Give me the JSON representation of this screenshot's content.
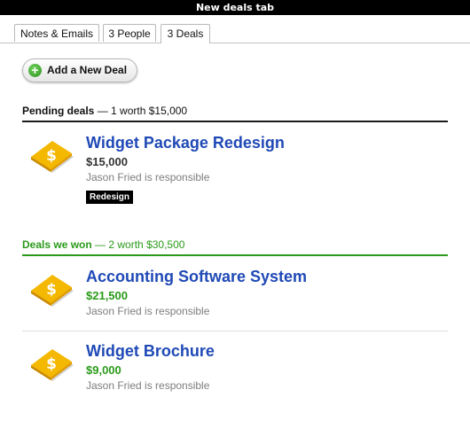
{
  "window": {
    "title": "New deals tab"
  },
  "tabs": [
    {
      "label": "Notes & Emails"
    },
    {
      "label": "3 People"
    },
    {
      "label": "3 Deals"
    }
  ],
  "add_button": {
    "label": "Add a New Deal"
  },
  "pending": {
    "title": "Pending deals",
    "summary": "— 1 worth $15,000",
    "color": "#111111",
    "deals": [
      {
        "name": "Widget Package Redesign",
        "amount": "$15,000",
        "responsible": "Jason Fried is responsible",
        "tag": "Redesign"
      }
    ]
  },
  "won": {
    "title": "Deals we won",
    "summary": "— 2 worth $30,500",
    "color": "#2a9a1a",
    "deals": [
      {
        "name": "Accounting Software System",
        "amount": "$21,500",
        "responsible": "Jason Fried is responsible"
      },
      {
        "name": "Widget Brochure",
        "amount": "$9,000",
        "responsible": "Jason Fried is responsible"
      }
    ]
  },
  "colors": {
    "link": "#1f49b6",
    "won": "#2a9a1a",
    "amount_pending": "#333333"
  }
}
